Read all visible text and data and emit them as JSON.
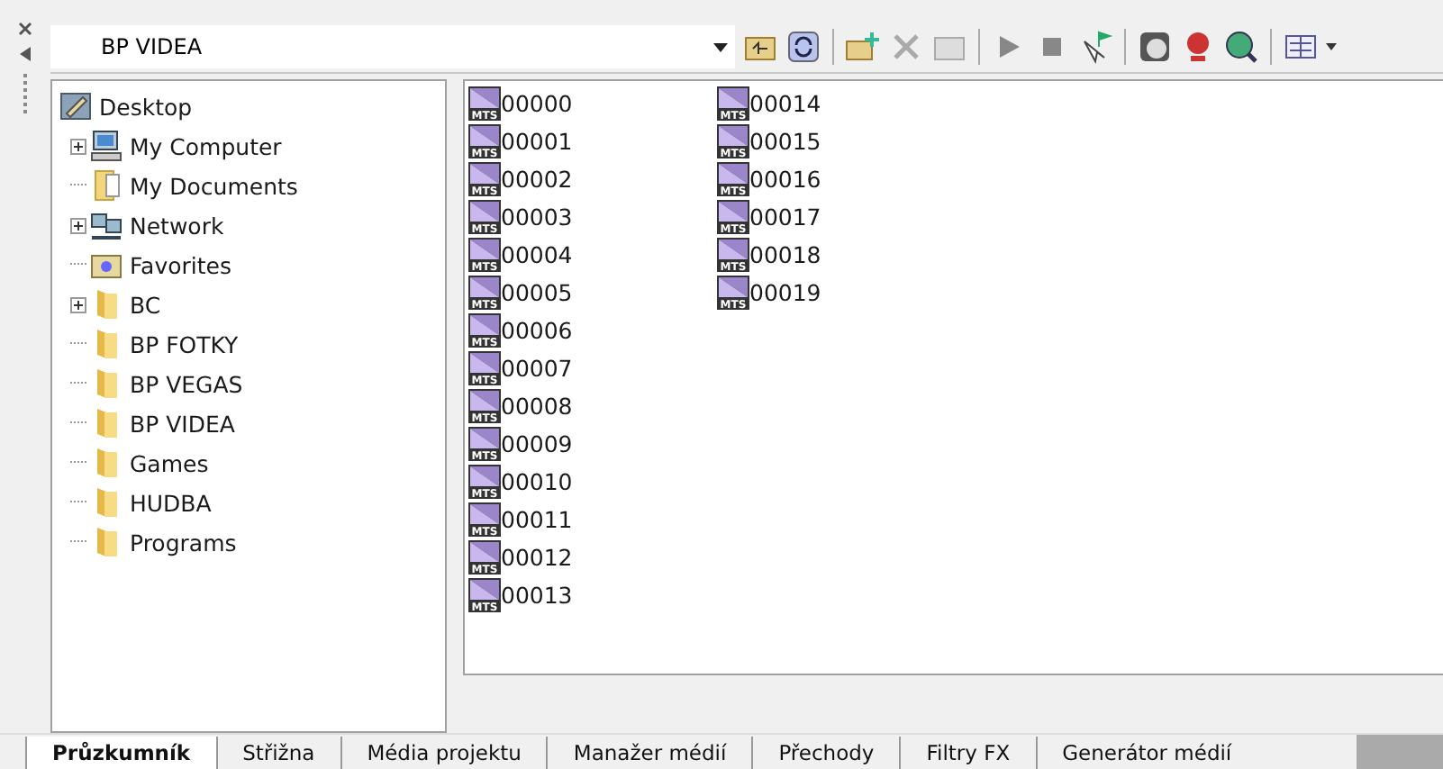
{
  "location": {
    "value": "BP VIDEA"
  },
  "tree": {
    "label": "Desktop",
    "kind": "desktop",
    "children": [
      {
        "label": "My Computer",
        "kind": "computer",
        "expandable": true
      },
      {
        "label": "My Documents",
        "kind": "documents",
        "expandable": false
      },
      {
        "label": "Network",
        "kind": "network",
        "expandable": true
      },
      {
        "label": "Favorites",
        "kind": "favorites",
        "expandable": false
      },
      {
        "label": "BC",
        "kind": "folder",
        "expandable": true
      },
      {
        "label": "BP FOTKY",
        "kind": "folder",
        "expandable": false
      },
      {
        "label": "BP VEGAS",
        "kind": "folder",
        "expandable": false
      },
      {
        "label": "BP VIDEA",
        "kind": "folder",
        "expandable": false
      },
      {
        "label": "Games",
        "kind": "folder",
        "expandable": false
      },
      {
        "label": "HUDBA",
        "kind": "folder",
        "expandable": false
      },
      {
        "label": "Programs",
        "kind": "folder",
        "expandable": false
      }
    ]
  },
  "files": [
    {
      "name": "00000",
      "icon_label": "MTS"
    },
    {
      "name": "00001",
      "icon_label": "MTS"
    },
    {
      "name": "00002",
      "icon_label": "MTS"
    },
    {
      "name": "00003",
      "icon_label": "MTS"
    },
    {
      "name": "00004",
      "icon_label": "MTS"
    },
    {
      "name": "00005",
      "icon_label": "MTS"
    },
    {
      "name": "00006",
      "icon_label": "MTS"
    },
    {
      "name": "00007",
      "icon_label": "MTS"
    },
    {
      "name": "00008",
      "icon_label": "MTS"
    },
    {
      "name": "00009",
      "icon_label": "MTS"
    },
    {
      "name": "00010",
      "icon_label": "MTS"
    },
    {
      "name": "00011",
      "icon_label": "MTS"
    },
    {
      "name": "00012",
      "icon_label": "MTS"
    },
    {
      "name": "00013",
      "icon_label": "MTS"
    },
    {
      "name": "00014",
      "icon_label": "MTS"
    },
    {
      "name": "00015",
      "icon_label": "MTS"
    },
    {
      "name": "00016",
      "icon_label": "MTS"
    },
    {
      "name": "00017",
      "icon_label": "MTS"
    },
    {
      "name": "00018",
      "icon_label": "MTS"
    },
    {
      "name": "00019",
      "icon_label": "MTS"
    }
  ],
  "tabs": [
    {
      "label": "Průzkumník",
      "selected": true
    },
    {
      "label": "Střižna",
      "selected": false
    },
    {
      "label": "Média projektu",
      "selected": false
    },
    {
      "label": "Manažer médií",
      "selected": false
    },
    {
      "label": "Přechody",
      "selected": false
    },
    {
      "label": "Filtry FX",
      "selected": false
    },
    {
      "label": "Generátor médií",
      "selected": false
    }
  ]
}
